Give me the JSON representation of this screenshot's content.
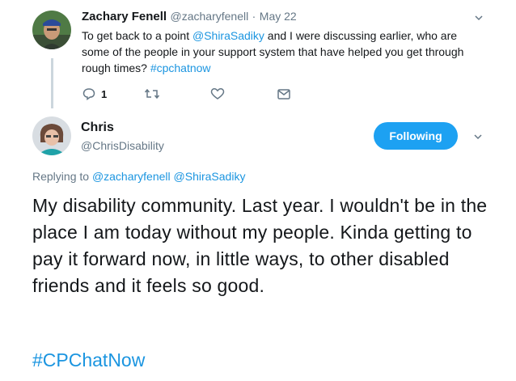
{
  "parent_tweet": {
    "name": "Zachary Fenell",
    "handle": "@zacharyfenell",
    "separator": "·",
    "date": "May 22",
    "text_parts": [
      "To get back to a point ",
      "@ShiraSadiky",
      " and I were discussing earlier, who are some of the people in your support system that have helped you get through rough times? ",
      "#cpchatnow"
    ],
    "reply_count": "1"
  },
  "main_tweet": {
    "name": "Chris",
    "handle": "@ChrisDisability",
    "follow_label": "Following",
    "replying_to_label": "Replying to",
    "replying_to_users": [
      "@zacharyfenell",
      "@ShiraSadiky"
    ],
    "text": "My disability community. Last year. I wouldn't be in the place I am today without my people. Kinda getting to pay it forward now, in little ways, to other disabled friends and it feels so good.",
    "hashtag": "#CPChatNow"
  },
  "colors": {
    "link": "#1b95e0",
    "follow_button": "#1da1f2",
    "secondary_text": "#657786",
    "thread_line": "#ccd6dd"
  },
  "icons": [
    "chevron-down-icon",
    "reply-icon",
    "retweet-icon",
    "like-icon",
    "direct-message-icon"
  ]
}
